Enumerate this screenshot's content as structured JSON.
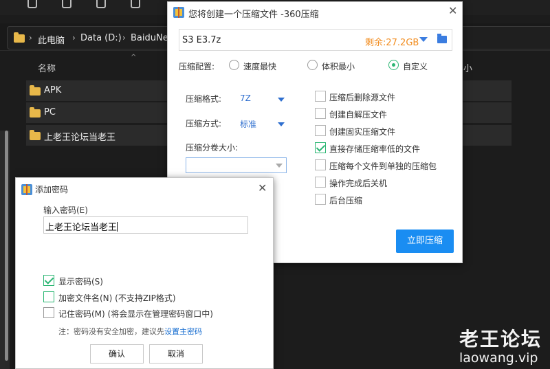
{
  "explorer": {
    "breadcrumbs": [
      "此电脑",
      "Data (D:)",
      "BaiduNet"
    ],
    "column_name": "名称",
    "column_right": "小",
    "rows": [
      {
        "name": "APK"
      },
      {
        "name": "PC"
      },
      {
        "name": "上老王论坛当老王"
      }
    ]
  },
  "compress_dialog": {
    "title": "您将创建一个压缩文件 -360压缩",
    "filename": "S3 E3.7z",
    "free_space": "剩余:27.2GB",
    "config_label": "压缩配置:",
    "config_options": [
      "速度最快",
      "体积最小",
      "自定义"
    ],
    "config_selected": "自定义",
    "format_label": "压缩格式:",
    "format_value": "7Z",
    "method_label": "压缩方式:",
    "method_value": "标准",
    "volume_label": "压缩分卷大小:",
    "volume_value": "",
    "options": [
      {
        "label": "压缩后删除源文件",
        "checked": false
      },
      {
        "label": "创建自解压文件",
        "checked": false
      },
      {
        "label": "创建固实压缩文件",
        "checked": false
      },
      {
        "label": "直接存储压缩率低的文件",
        "checked": true
      },
      {
        "label": "压缩每个文件到单独的压缩包",
        "checked": false
      },
      {
        "label": "操作完成后关机",
        "checked": false
      },
      {
        "label": "后台压缩",
        "checked": false
      }
    ],
    "compress_button": "立即压缩"
  },
  "password_dialog": {
    "title": "添加密码",
    "input_label": "输入密码(E)",
    "password_value": "上老王论坛当老王",
    "show_password": "显示密码(S)",
    "show_password_checked": true,
    "encrypt_names": "加密文件名(N) (不支持ZIP格式)",
    "encrypt_names_checked": false,
    "remember": "记住密码(M) (将会显示在管理密码窗口中)",
    "remember_checked": false,
    "note": "注：密码没有安全加密，建议先",
    "note_link": "设置主密码",
    "ok_button": "确认",
    "cancel_button": "取消"
  },
  "watermark": {
    "logo_text": "老王论坛",
    "url": "laowang.vip"
  }
}
